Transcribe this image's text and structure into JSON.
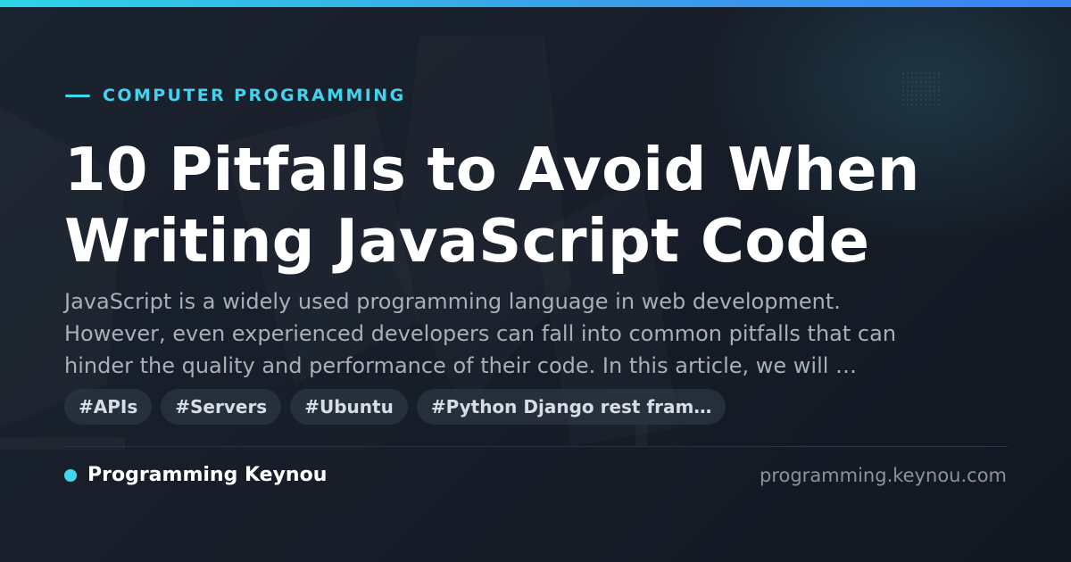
{
  "card": {
    "category": "COMPUTER PROGRAMMING",
    "title_line1": "10 Pitfalls to Avoid When",
    "title_line2": "Writing JavaScript Code",
    "description_line1": "JavaScript is a widely used programming language in web development.",
    "description_line2": "However, even experienced developers can fall into common pitfalls that can",
    "description_line3": "hinder the quality and performance of their code. In this article, we will …",
    "tags": [
      "#APIs",
      "#Servers",
      "#Ubuntu",
      "#Python Django rest fram…"
    ],
    "brand_name": "Programming Keynou",
    "domain": "programming.keynou.com"
  },
  "colors": {
    "accent": "#43d3ef",
    "background": "#141a23",
    "title": "#ffffff",
    "description": "#a7afba",
    "tag_background": "#2c3644",
    "domain": "#8a929e"
  },
  "icons": {
    "category_marker": "accent-line",
    "brand_marker": "dot-icon"
  }
}
